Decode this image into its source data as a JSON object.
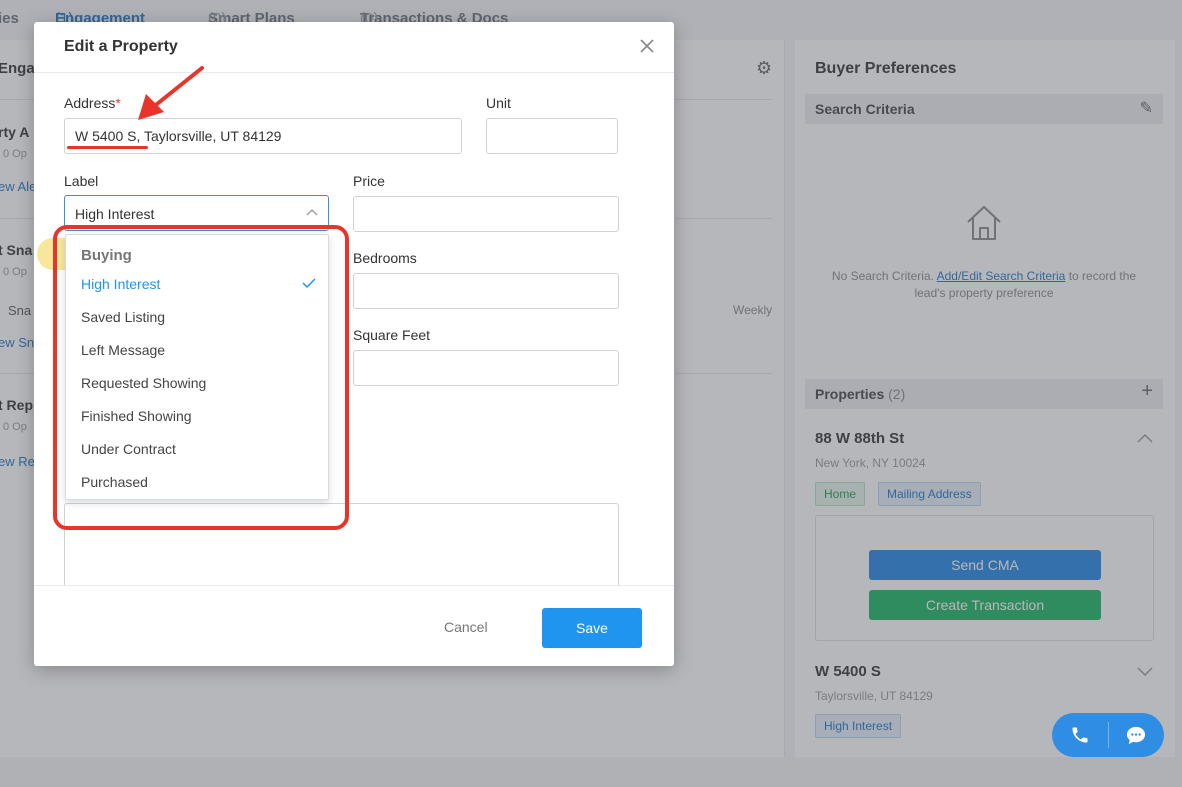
{
  "background": {
    "tabs": [
      {
        "label": "ies",
        "count": ""
      },
      {
        "label": "Engagement",
        "count": "(1)"
      },
      {
        "label": "Smart Plans",
        "count": "(0)"
      },
      {
        "label": "Transactions & Docs",
        "count": "(0)"
      }
    ],
    "left": {
      "header": "Enga",
      "rows": [
        {
          "title": "rty A",
          "sub": "0 Op",
          "link": "ew Ale"
        },
        {
          "title": "t Sna",
          "sub": "0 Op",
          "text": "Sna",
          "link": "ew Sn"
        },
        {
          "title": "t Rep",
          "sub": "0 Op",
          "link": "ew Re"
        }
      ],
      "frequency": "Weekly"
    },
    "right": {
      "title": "Buyer Preferences",
      "search_criteria_header": "Search Criteria",
      "no_criteria_prefix": "No Search Criteria.",
      "no_criteria_link": "Add/Edit Search Criteria",
      "no_criteria_suffix": "to record the lead's property preference",
      "properties_header": "Properties",
      "properties_count": "(2)",
      "property1": {
        "address": "88 W 88th St",
        "city": "New York, NY 10024",
        "tags": [
          "Home",
          "Mailing Address"
        ]
      },
      "send_cma": "Send CMA",
      "create_transaction": "Create Transaction",
      "property2": {
        "address": "W 5400 S",
        "city": "Taylorsville, UT 84129",
        "tag": "High Interest"
      }
    }
  },
  "modal": {
    "title": "Edit a Property",
    "address_label": "Address",
    "required_mark": "*",
    "address_value": "W 5400 S, Taylorsville, UT 84129",
    "unit_label": "Unit",
    "unit_value": "",
    "label_label": "Label",
    "label_selected": "High Interest",
    "price_label": "Price",
    "bedrooms_label": "Bedrooms",
    "square_feet_label": "Square Feet",
    "cancel": "Cancel",
    "save": "Save"
  },
  "dropdown": {
    "group": "Buying",
    "options": [
      "High Interest",
      "Saved Listing",
      "Left Message",
      "Requested Showing",
      "Finished Showing",
      "Under Contract",
      "Purchased"
    ],
    "selected": "High Interest"
  },
  "colors": {
    "accent": "#1f95f0",
    "annotation": "#e8342a",
    "highlight": "#f7e38a"
  }
}
